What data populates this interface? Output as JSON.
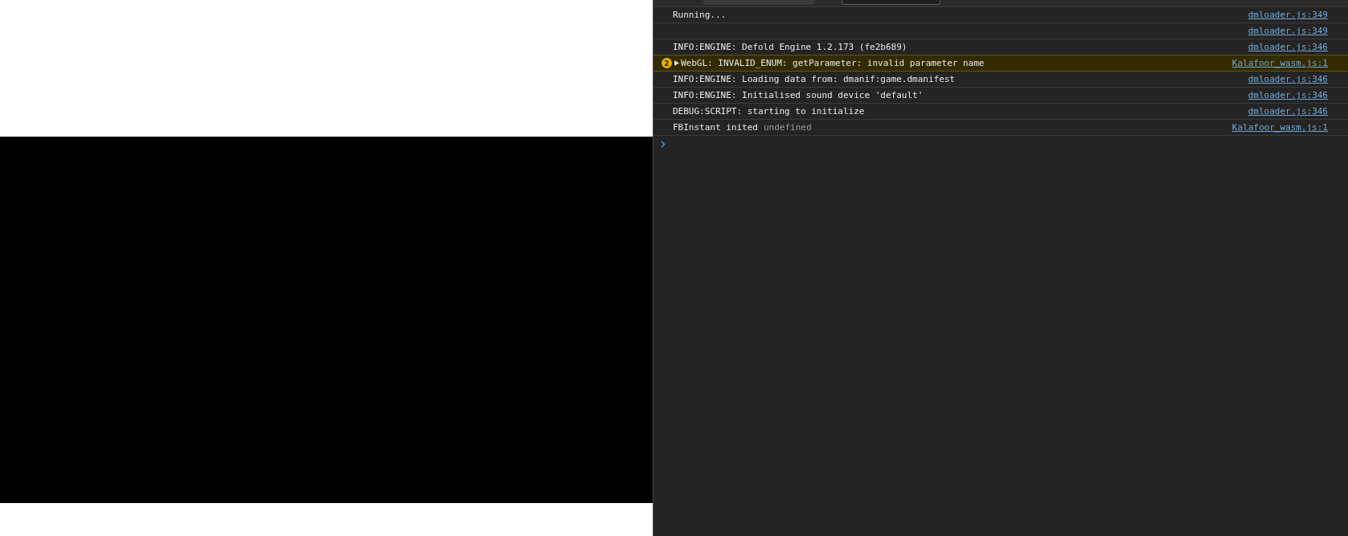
{
  "console": {
    "messages": [
      {
        "kind": "log",
        "text": "Running...",
        "source": "dmloader.js:349"
      },
      {
        "kind": "log",
        "source": "dmloader.js:349"
      },
      {
        "kind": "log",
        "text": "INFO:ENGINE: Defold Engine 1.2.173 (fe2b689)",
        "source": "dmloader.js:346"
      },
      {
        "kind": "warning",
        "count": "2",
        "expanded": false,
        "text": "WebGL: INVALID_ENUM: getParameter: invalid parameter name",
        "source": "Kalafoor_wasm.js:1"
      },
      {
        "kind": "log",
        "text": "INFO:ENGINE: Loading data from: dmanif:game.dmanifest",
        "source": "dmloader.js:346"
      },
      {
        "kind": "log",
        "text": "INFO:ENGINE: Initialised sound device 'default'",
        "source": "dmloader.js:346"
      },
      {
        "kind": "log",
        "text": "DEBUG:SCRIPT: starting to initialize",
        "source": "dmloader.js:346"
      },
      {
        "kind": "log",
        "text": "FBInstant inited",
        "detail": "undefined",
        "source": "Kalafoor_wasm.js:1"
      }
    ]
  }
}
